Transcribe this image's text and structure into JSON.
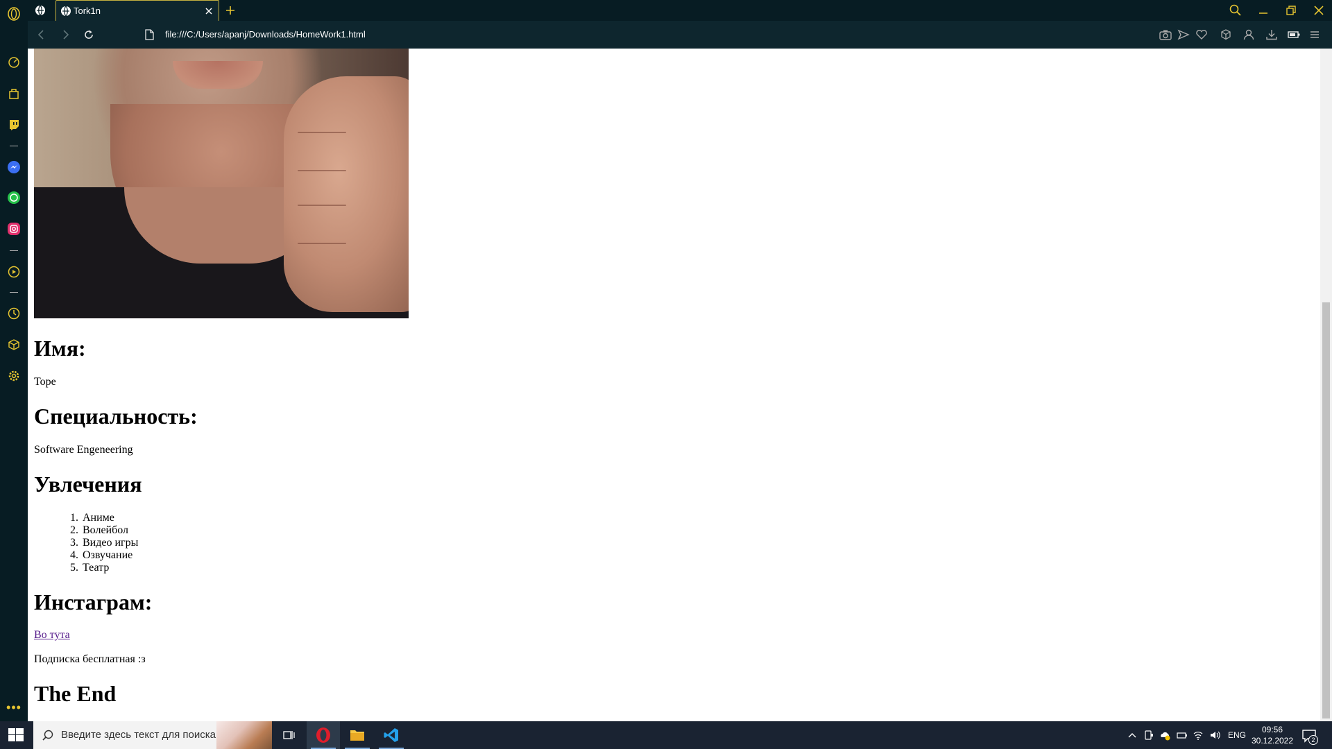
{
  "browser": {
    "tab": {
      "title": "Tork1n"
    },
    "address": {
      "url": "file:///C:/Users/apanj/Downloads/HomeWork1.html"
    }
  },
  "page": {
    "sections": [
      {
        "heading": "Имя:",
        "text": "Tope"
      },
      {
        "heading": "Специальность:",
        "text": "Software Engeneering"
      },
      {
        "heading": "Увлечения"
      },
      {
        "heading": "Инстаграм:",
        "link_text": "Во тута",
        "text": "Подписка бесплатная :з"
      },
      {
        "heading": "The End"
      }
    ],
    "hobbies": [
      {
        "num": "1.",
        "label": "Аниме"
      },
      {
        "num": "2.",
        "label": "Волейбол"
      },
      {
        "num": "3.",
        "label": "Видео игры"
      },
      {
        "num": "4.",
        "label": "Озвучание"
      },
      {
        "num": "5.",
        "label": "Театр"
      }
    ]
  },
  "taskbar": {
    "search_placeholder": "Введите здесь текст для поиска",
    "language": "ENG",
    "time": "09:56",
    "date": "30.12.2022",
    "notification_count": "2"
  },
  "colors": {
    "browser_chrome": "#071c23",
    "accent": "#e6c531",
    "taskbar": "#1a2332",
    "visited_link": "#551a8b"
  },
  "icons": {
    "sidebar": [
      "opera-logo-icon",
      "speed-dial-icon",
      "bag-icon",
      "twitch-icon",
      "messenger-icon",
      "whatsapp-icon",
      "instagram-icon",
      "player-icon",
      "history-icon",
      "cube-icon",
      "settings-icon",
      "more-icon"
    ],
    "toolbar": [
      "camera-icon",
      "send-icon",
      "heart-icon",
      "cube-icon",
      "profile-icon",
      "download-icon",
      "battery-icon",
      "menu-icon"
    ]
  }
}
